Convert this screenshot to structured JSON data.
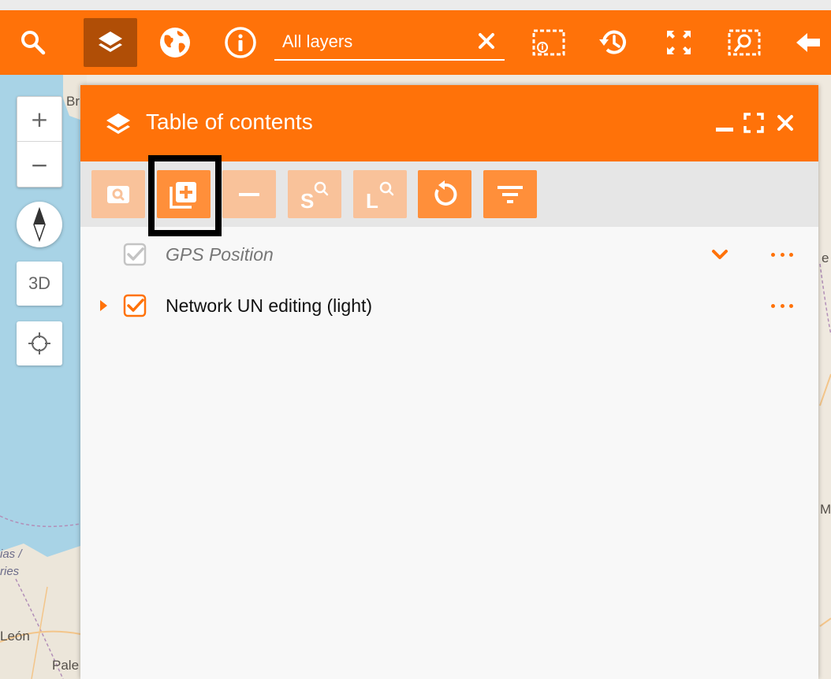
{
  "toolbar": {
    "search_placeholder": "All layers",
    "buttons": [
      {
        "name": "search-icon"
      },
      {
        "name": "layers-icon",
        "active": true
      },
      {
        "name": "globe-icon"
      },
      {
        "name": "info-icon"
      },
      {
        "name": "select-info-icon"
      },
      {
        "name": "history-icon"
      },
      {
        "name": "fullscreen-icon"
      },
      {
        "name": "zoom-select-icon"
      },
      {
        "name": "back-arrow-icon"
      }
    ]
  },
  "map_controls": {
    "zoom_in": "+",
    "zoom_out": "−",
    "view_3d": "3D"
  },
  "map_labels": {
    "bri": "Bri",
    "asturias": "ias /",
    "asturias2": "ries",
    "leon": "León",
    "palencia": "Pale",
    "right_e": "e",
    "right_m": "M"
  },
  "panel": {
    "title": "Table of contents",
    "tools": [
      {
        "name": "zoom-to-layer-button",
        "enabled": false
      },
      {
        "name": "add-layer-button",
        "enabled": true,
        "highlighted": true
      },
      {
        "name": "remove-layer-button",
        "enabled": false
      },
      {
        "name": "search-s-button",
        "enabled": false
      },
      {
        "name": "search-l-button",
        "enabled": false
      },
      {
        "name": "refresh-button",
        "enabled": true
      },
      {
        "name": "filter-button",
        "enabled": true
      }
    ],
    "layers": [
      {
        "label": "GPS Position",
        "checked": true,
        "disabled": true,
        "has_chevron": true,
        "has_expander": false
      },
      {
        "label": "Network UN editing (light)",
        "checked": true,
        "disabled": false,
        "has_chevron": false,
        "has_expander": true
      }
    ]
  },
  "colors": {
    "accent": "#ff7209",
    "accent_dark": "#b04e06",
    "accent_disabled": "#f9c29a",
    "panel_bg": "#f8f8f8"
  }
}
